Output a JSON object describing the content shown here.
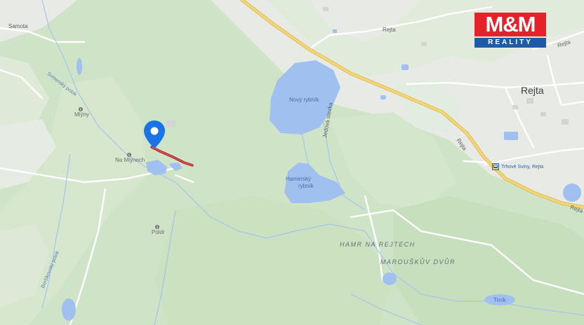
{
  "map": {
    "colors": {
      "land": "#e8eae6",
      "forest": "#cfe4c6",
      "forest_dark": "#c3dcb8",
      "water": "#a0c0f0",
      "stream": "#a8c4ee",
      "major_road": "#f2d77a",
      "major_road_edge": "#e0b84e",
      "minor_road": "#ffffff",
      "route_line": "#b3202a",
      "pin": "#1a73e8"
    },
    "labels": {
      "samota": "Samota",
      "rejta_road_top": "Rejta",
      "rejta_road_right": "Rejta",
      "rejta_town": "Rejta",
      "rejta_road_diag": "Rejta",
      "svinensky_potok": "Svinenský potok",
      "mlyny": "Mlýny",
      "na_mlynech": "Na Mlýnech",
      "poldr": "Poldr",
      "novy_rybnik": "Nový rybník",
      "hamersky_rybnik_1": "Hamerský",
      "hamersky_rybnik_2": "rybník",
      "jedova_stezka": "Jedová stezka",
      "hamr_na_rejtech": "HAMR NA REJTECH",
      "marouskuv_dvur": "MAROUŠKŮV DVŮR",
      "bus_stop": "Trhové Sviny, Rejta",
      "borsikovsky_potok": "Boršíkovský potok",
      "trnik": "Trník"
    },
    "icons": {
      "poi": "info-marker-icon",
      "bus": "bus-stop-icon",
      "pin": "location-pin-icon"
    }
  },
  "logo": {
    "mark": "M&M",
    "tagline": "REALITY"
  }
}
